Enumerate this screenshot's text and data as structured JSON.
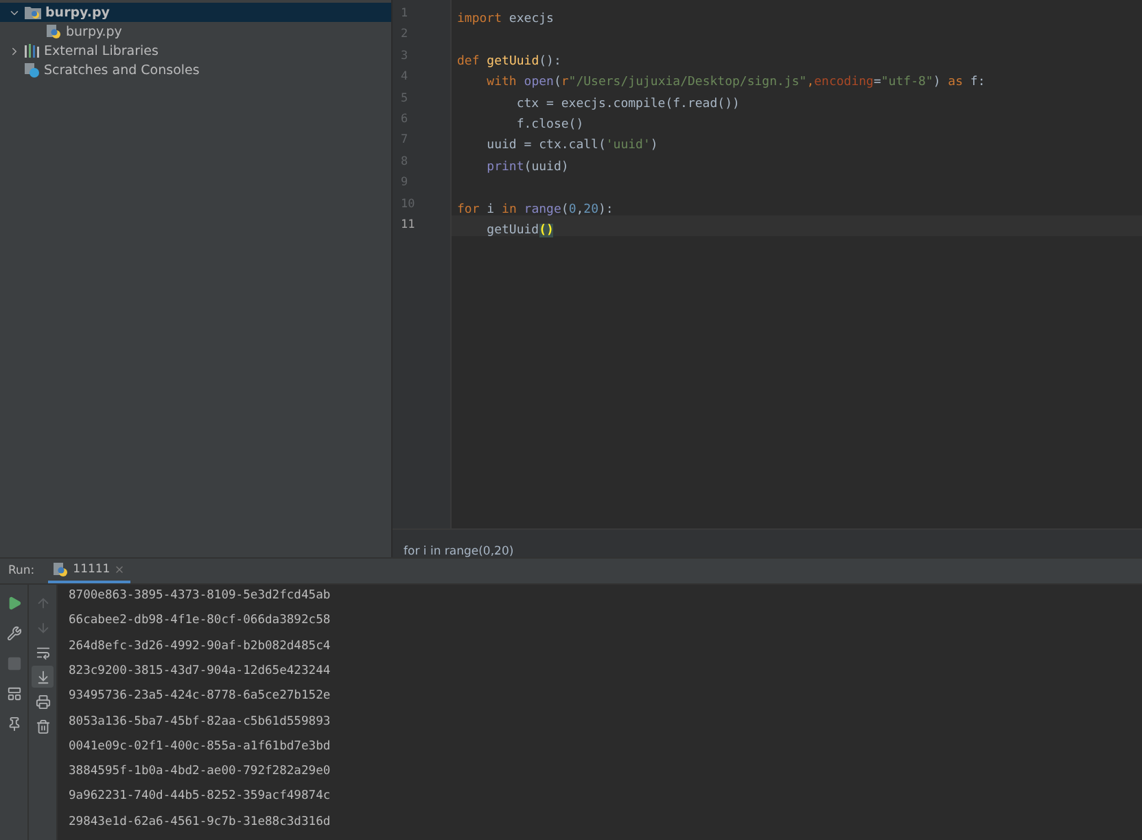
{
  "project_tree": [
    {
      "label": "burpy.py",
      "kind": "folder",
      "expanded": true,
      "selected": true,
      "children": [
        {
          "label": "burpy.py",
          "kind": "python",
          "selected": false
        }
      ]
    },
    {
      "label": "External Libraries",
      "kind": "library",
      "expanded": false,
      "selected": false
    },
    {
      "label": "Scratches and Consoles",
      "kind": "scratch",
      "selected": false
    }
  ],
  "editor": {
    "lines": [
      {
        "number": "1",
        "current": false,
        "tokens": [
          {
            "kind": "keyword",
            "text": "import"
          },
          {
            "kind": "plain",
            "text": " execjs"
          }
        ]
      },
      {
        "number": "2",
        "current": false
      },
      {
        "number": "3",
        "current": false,
        "tokens": [
          {
            "kind": "keyword",
            "text": "def"
          },
          {
            "kind": "function",
            "text": " getUuid"
          },
          {
            "kind": "plain",
            "text": "():"
          }
        ]
      },
      {
        "number": "4",
        "current": false,
        "tokens": [
          {
            "kind": "keyword",
            "text": "    with"
          },
          {
            "kind": "builtin",
            "text": " open"
          },
          {
            "kind": "plain",
            "text": "("
          },
          {
            "kind": "keyword",
            "text": "r"
          },
          {
            "kind": "string",
            "text": "\"/Users/jujuxia/Desktop/sign.js\""
          },
          {
            "kind": "keyword",
            "text": ","
          },
          {
            "kind": "param",
            "text": "encoding"
          },
          {
            "kind": "plain",
            "text": "="
          },
          {
            "kind": "string",
            "text": "\"utf-8\""
          },
          {
            "kind": "plain",
            "text": ") "
          },
          {
            "kind": "keyword",
            "text": "as"
          },
          {
            "kind": "plain",
            "text": " f:"
          }
        ]
      },
      {
        "number": "5",
        "current": false,
        "tokens": [
          {
            "kind": "plain",
            "text": "        ctx = execjs.compile(f.read())"
          }
        ]
      },
      {
        "number": "6",
        "current": false,
        "tokens": [
          {
            "kind": "plain",
            "text": "        f.close()"
          }
        ]
      },
      {
        "number": "7",
        "current": false,
        "tokens": [
          {
            "kind": "plain",
            "text": "    uuid = ctx.call("
          },
          {
            "kind": "string",
            "text": "'uuid'"
          },
          {
            "kind": "plain",
            "text": ")"
          }
        ]
      },
      {
        "number": "8",
        "current": false,
        "tokens": [
          {
            "kind": "builtin",
            "text": "    print"
          },
          {
            "kind": "plain",
            "text": "(uuid)"
          }
        ]
      },
      {
        "number": "9",
        "current": false
      },
      {
        "number": "10",
        "current": false,
        "tokens": [
          {
            "kind": "keyword",
            "text": "for"
          },
          {
            "kind": "plain",
            "text": " i "
          },
          {
            "kind": "keyword",
            "text": "in"
          },
          {
            "kind": "builtin",
            "text": " range"
          },
          {
            "kind": "plain",
            "text": "("
          },
          {
            "kind": "number",
            "text": "0"
          },
          {
            "kind": "plain",
            "text": ","
          },
          {
            "kind": "number",
            "text": "20"
          },
          {
            "kind": "plain",
            "text": "):"
          }
        ]
      },
      {
        "number": "11",
        "current": true,
        "tokens": [
          {
            "kind": "plain",
            "text": "    getUuid"
          },
          {
            "kind": "brace_match",
            "text": "()"
          }
        ]
      }
    ],
    "breadcrumb": "for i in range(0,20)"
  },
  "run_panel": {
    "label": "Run:",
    "tabs": [
      {
        "label": "11111",
        "selected": true
      }
    ],
    "left_tools": [
      {
        "kind": "rerun",
        "disabled": false
      },
      {
        "kind": "settings",
        "disabled": false
      },
      {
        "kind": "stop",
        "disabled": true
      },
      {
        "kind": "layout",
        "disabled": false
      },
      {
        "kind": "pin",
        "disabled": false
      }
    ],
    "right_tools": [
      {
        "kind": "up",
        "on": false,
        "disabled": true
      },
      {
        "kind": "down",
        "on": false,
        "disabled": true
      },
      {
        "kind": "wrap",
        "on": false,
        "disabled": false
      },
      {
        "kind": "scroll_end",
        "on": true,
        "disabled": false
      },
      {
        "kind": "print",
        "on": false,
        "disabled": false
      },
      {
        "kind": "trash",
        "on": false,
        "disabled": false
      }
    ],
    "output": [
      "8700e863-3895-4373-8109-5e3d2fcd45ab",
      "66cabee2-db98-4f1e-80cf-066da3892c58",
      "264d8efc-3d26-4992-90af-b2b082d485c4",
      "823c9200-3815-43d7-904a-12d65e423244",
      "93495736-23a5-424c-8778-6a5ce27b152e",
      "8053a136-5ba7-45bf-82aa-c5b61d559893",
      "0041e09c-02f1-400c-855a-a1f61bd7e3bd",
      "3884595f-1b0a-4bd2-ae00-792f282a29e0",
      "9a962231-740d-44b5-8252-359acf49874c",
      "29843e1d-62a6-4561-9c7b-31e88c3d316d"
    ]
  }
}
